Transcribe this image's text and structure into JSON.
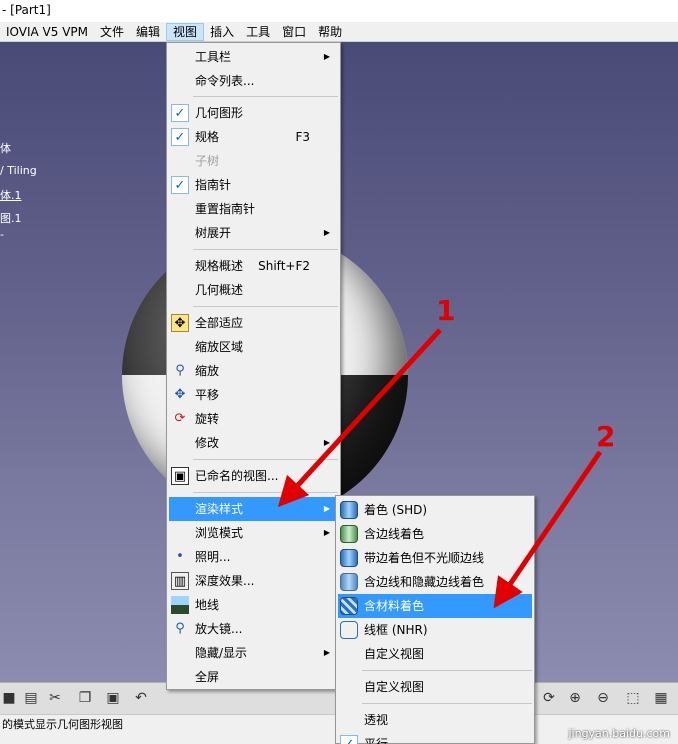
{
  "window": {
    "title": "- [Part1]"
  },
  "menubar": {
    "items": [
      "IOVIA V5 VPM",
      "文件",
      "编辑",
      "视图",
      "插入",
      "工具",
      "窗口",
      "帮助"
    ]
  },
  "tree": {
    "items": [
      "体",
      "/ Tiling",
      "体.1",
      "图.1",
      "-"
    ]
  },
  "view_menu": {
    "items": [
      {
        "label": "工具栏"
      },
      {
        "label": "命令列表..."
      },
      {
        "label": "几何图形"
      },
      {
        "label": "规格",
        "shortcut": "F3"
      },
      {
        "label": "子树"
      },
      {
        "label": "指南针"
      },
      {
        "label": "重置指南针"
      },
      {
        "label": "树展开"
      },
      {
        "label": "规格概述",
        "shortcut": "Shift+F2"
      },
      {
        "label": "几何概述"
      },
      {
        "label": "全部适应"
      },
      {
        "label": "缩放区域"
      },
      {
        "label": "缩放"
      },
      {
        "label": "平移"
      },
      {
        "label": "旋转"
      },
      {
        "label": "修改"
      },
      {
        "label": "已命名的视图..."
      },
      {
        "label": "渲染样式"
      },
      {
        "label": "浏览模式"
      },
      {
        "label": "照明..."
      },
      {
        "label": "深度效果..."
      },
      {
        "label": "地线"
      },
      {
        "label": "放大镜..."
      },
      {
        "label": "隐藏/显示"
      },
      {
        "label": "全屏"
      }
    ]
  },
  "render_submenu": {
    "items": [
      {
        "label": "着色 (SHD)"
      },
      {
        "label": "含边线着色"
      },
      {
        "label": "带边着色但不光顺边线"
      },
      {
        "label": "含边线和隐藏边线着色"
      },
      {
        "label": "含材料着色"
      },
      {
        "label": "线框 (NHR)"
      },
      {
        "label": "自定义视图"
      },
      {
        "label": "自定义视图"
      },
      {
        "label": "透视"
      },
      {
        "label": "平行"
      }
    ]
  },
  "annotations": {
    "one": "1",
    "two": "2"
  },
  "status": {
    "text": "的模式显示几何图形视图"
  },
  "watermark": {
    "text": "jingyan.baidu.com"
  },
  "colors": {
    "highlight": "#3399ff",
    "arrow": "#e00000"
  }
}
